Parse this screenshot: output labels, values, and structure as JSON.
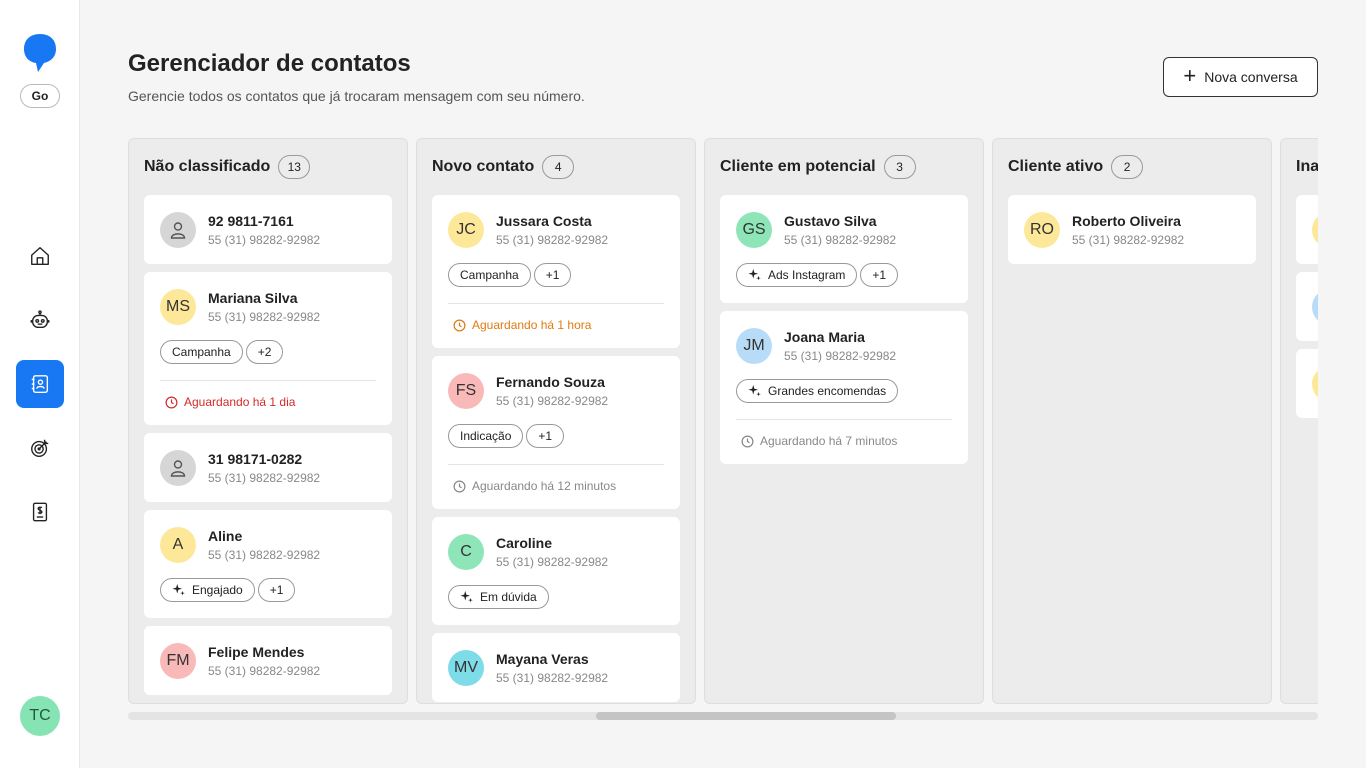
{
  "sidebar": {
    "plan": "Go",
    "user_initials": "TC",
    "items": [
      {
        "icon": "home-icon",
        "active": false
      },
      {
        "icon": "robot-icon",
        "active": false
      },
      {
        "icon": "contacts-icon",
        "active": true
      },
      {
        "icon": "target-icon",
        "active": false
      },
      {
        "icon": "billing-icon",
        "active": false
      }
    ],
    "accent": "#1877f2"
  },
  "header": {
    "title": "Gerenciador de contatos",
    "subtitle": "Gerencie todos os contatos que já trocaram mensagem com seu número.",
    "new_button": "Nova conversa"
  },
  "columns": [
    {
      "title": "Não classificado",
      "count": "13",
      "cards": [
        {
          "initials": "",
          "color": "grey",
          "name": "92 9811-7161",
          "phone": "55 (31) 98282-92982",
          "tags": [],
          "waiting": null
        },
        {
          "initials": "MS",
          "color": "yellow",
          "name": "Mariana Silva",
          "phone": "55 (31) 98282-92982",
          "tags": [
            {
              "label": "Campanha",
              "spark": false
            },
            {
              "label": "+2",
              "spark": false
            }
          ],
          "waiting": {
            "text": "Aguardando há 1 dia",
            "tone": "red"
          }
        },
        {
          "initials": "",
          "color": "grey",
          "name": "31 98171-0282",
          "phone": "55 (31) 98282-92982",
          "tags": [],
          "waiting": null
        },
        {
          "initials": "A",
          "color": "yellow",
          "name": "Aline",
          "phone": "55 (31) 98282-92982",
          "tags": [
            {
              "label": "Engajado",
              "spark": true
            },
            {
              "label": "+1",
              "spark": false
            }
          ],
          "waiting": null
        },
        {
          "initials": "FM",
          "color": "pink",
          "name": "Felipe Mendes",
          "phone": "55 (31) 98282-92982",
          "tags": [],
          "waiting": null
        }
      ]
    },
    {
      "title": "Novo contato",
      "count": "4",
      "cards": [
        {
          "initials": "JC",
          "color": "yellow",
          "name": "Jussara Costa",
          "phone": "55 (31) 98282-92982",
          "tags": [
            {
              "label": "Campanha",
              "spark": false
            },
            {
              "label": "+1",
              "spark": false
            }
          ],
          "waiting": {
            "text": "Aguardando há 1 hora",
            "tone": "orange"
          }
        },
        {
          "initials": "FS",
          "color": "pink",
          "name": "Fernando Souza",
          "phone": "55 (31) 98282-92982",
          "tags": [
            {
              "label": "Indicação",
              "spark": false
            },
            {
              "label": "+1",
              "spark": false
            }
          ],
          "waiting": {
            "text": "Aguardando há 12 minutos",
            "tone": "grey"
          }
        },
        {
          "initials": "C",
          "color": "green",
          "name": "Caroline",
          "phone": "55 (31) 98282-92982",
          "tags": [
            {
              "label": "Em dúvida",
              "spark": true
            }
          ],
          "waiting": null
        },
        {
          "initials": "MV",
          "color": "cyan",
          "name": "Mayana Veras",
          "phone": "55 (31) 98282-92982",
          "tags": [],
          "waiting": null
        }
      ]
    },
    {
      "title": "Cliente em potencial",
      "count": "3",
      "cards": [
        {
          "initials": "GS",
          "color": "green",
          "name": "Gustavo Silva",
          "phone": "55 (31) 98282-92982",
          "tags": [
            {
              "label": "Ads Instagram",
              "spark": true
            },
            {
              "label": "+1",
              "spark": false
            }
          ],
          "waiting": null
        },
        {
          "initials": "JM",
          "color": "blue",
          "name": "Joana Maria",
          "phone": "55 (31) 98282-92982",
          "tags": [
            {
              "label": "Grandes encomendas",
              "spark": true
            }
          ],
          "waiting": {
            "text": "Aguardando há 7 minutos",
            "tone": "grey"
          }
        }
      ]
    },
    {
      "title": "Cliente ativo",
      "count": "2",
      "cards": [
        {
          "initials": "RO",
          "color": "yellow",
          "name": "Roberto Oliveira",
          "phone": "55 (31) 98282-92982",
          "tags": [],
          "waiting": null
        }
      ]
    },
    {
      "title": "Ina",
      "count": "",
      "cards": [
        {
          "initials": "",
          "color": "yellow",
          "name": "",
          "phone": "",
          "tags": [],
          "waiting": null
        },
        {
          "initials": "",
          "color": "blue",
          "name": "",
          "phone": "",
          "tags": [],
          "waiting": null
        },
        {
          "initials": "",
          "color": "yellow",
          "name": "",
          "phone": "",
          "tags": [],
          "waiting": null
        }
      ]
    }
  ]
}
